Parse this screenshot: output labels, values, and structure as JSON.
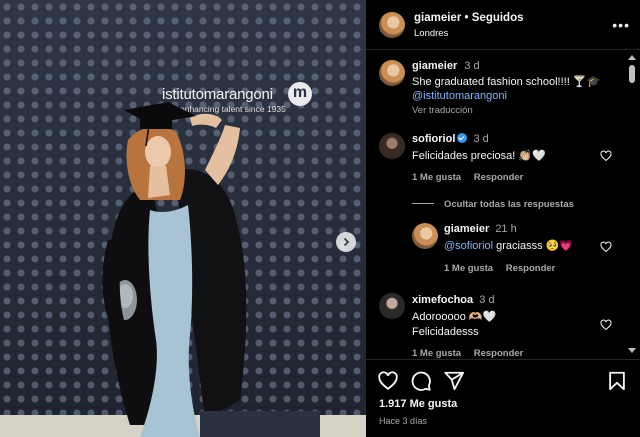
{
  "post": {
    "brand_word": "istitutomarangoni",
    "brand_tagline": "enhancing talent since 1935",
    "brand_mark": "m"
  },
  "header": {
    "username": "giameier",
    "separator": "•",
    "follow_status": "Seguidos",
    "location": "Londres"
  },
  "caption": {
    "username": "giameier",
    "time": "3 d",
    "text": "She graduated fashion school!!!! 🍸🎓",
    "mention": "@istitutomarangoni",
    "translate": "Ver traducción"
  },
  "comments": [
    {
      "username": "sofioriol",
      "verified": true,
      "time": "3 d",
      "text": "Felicidades preciosa! 👏🏼🤍",
      "likes": "1 Me gusta",
      "reply": "Responder"
    }
  ],
  "replies_toggle": "Ocultar todas las respuestas",
  "reply": {
    "username": "giameier",
    "time": "21 h",
    "mention": "@sofioriol",
    "text": " graciasss 🥺💗",
    "likes": "1 Me gusta",
    "reply": "Responder"
  },
  "comment2": {
    "username": "ximefochoa",
    "time": "3 d",
    "line1": "Adorooooo 🫶🏼🤍",
    "line2": "Felicidadesss",
    "likes": "1 Me gusta",
    "reply": "Responder"
  },
  "footer": {
    "likes": "1.917 Me gusta",
    "time": "Hace 3 días"
  },
  "icons": [
    "heart-icon",
    "comment-icon",
    "share-icon",
    "bookmark-icon",
    "more-icon",
    "chevron-right-icon"
  ],
  "colors": {
    "background": "#000000",
    "link": "#8ab4ff",
    "muted": "#a8a8a8",
    "verified": "#3897f0"
  }
}
